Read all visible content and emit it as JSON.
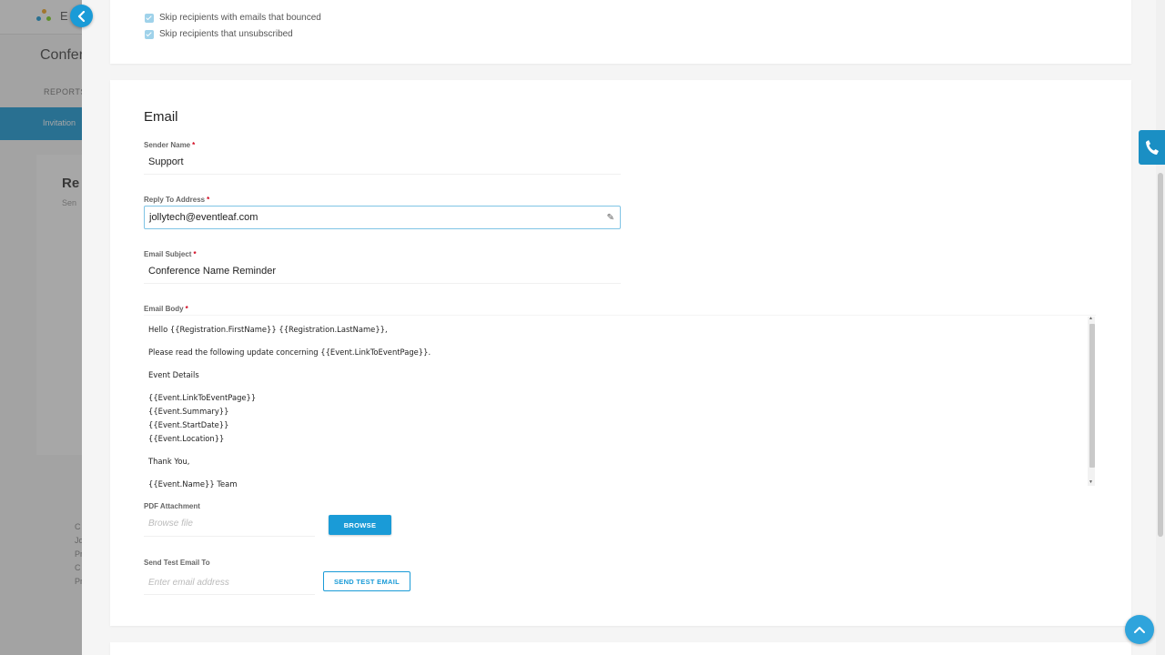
{
  "background": {
    "brand": "E",
    "title": "Confer",
    "reports_label": "REPORTS",
    "tab_label": "Invitation",
    "card_title": "Re",
    "card_sub": "Sen",
    "footer_lines": [
      "C",
      "Jo",
      "Pr",
      "C",
      "Pr"
    ]
  },
  "top_card": {
    "skip_bounced": "Skip recipients with emails that bounced",
    "skip_unsubscribed": "Skip recipients that unsubscribed"
  },
  "email": {
    "section_title": "Email",
    "sender_name_label": "Sender Name",
    "sender_name_value": "Support",
    "reply_to_label": "Reply To Address",
    "reply_to_value": "jollytech@eventleaf.com",
    "subject_label": "Email Subject",
    "subject_value": "Conference Name Reminder",
    "body_label": "Email Body",
    "body_lines": {
      "l1": "Hello {{Registration.FirstName}} {{Registration.LastName}},",
      "l2": "Please read the following update concerning {{Event.LinkToEventPage}}.",
      "l3": "Event Details",
      "l4": "{{Event.LinkToEventPage}}",
      "l5": "{{Event.Summary}}",
      "l6": "{{Event.StartDate}}",
      "l7": "{{Event.Location}}",
      "l8": "Thank You,",
      "l9": "{{Event.Name}} Team"
    },
    "pdf_label": "PDF Attachment",
    "pdf_placeholder": "Browse file",
    "browse_label": "BROWSE",
    "test_label": "Send Test Email To",
    "test_placeholder": "Enter email address",
    "send_test_label": "SEND TEST EMAIL",
    "required_mark": "*"
  },
  "colors": {
    "accent": "#1a9bd7",
    "required": "#d0021b"
  },
  "icons": {
    "back": "chevron-left-icon",
    "phone": "phone-icon",
    "scroll_top": "chevron-up-icon",
    "edit": "pencil-icon"
  }
}
